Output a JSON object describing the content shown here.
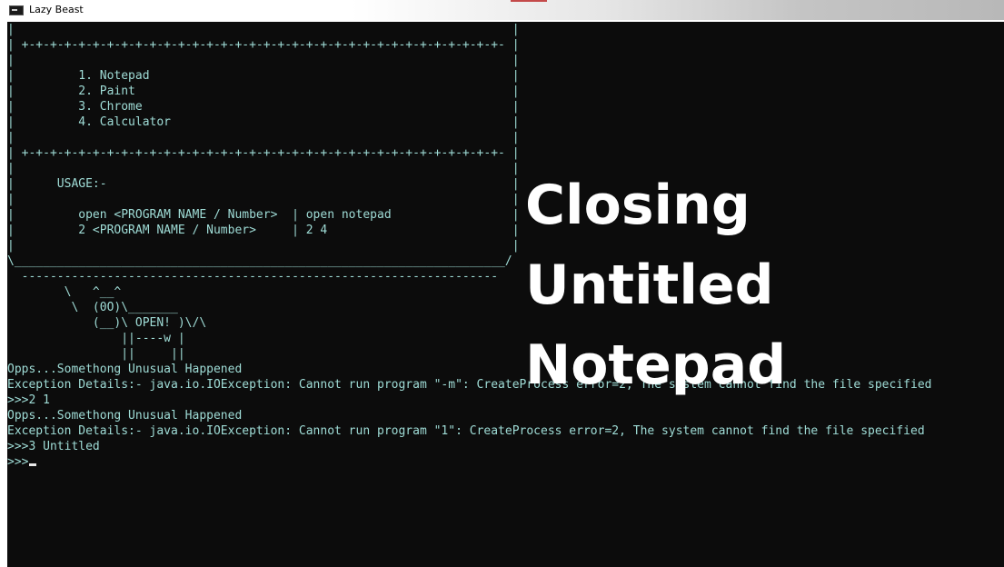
{
  "window": {
    "title": "Lazy Beast"
  },
  "console": {
    "lines": [
      "|                                                                      |",
      "| +-+-+-+-+-+-+-+-+-+-+-+-+-+-+-+-+-+-+-+-+-+-+-+-+-+-+-+-+-+-+-+-+-+- |",
      "|                                                                      |",
      "|         1. Notepad                                                   |",
      "|         2. Paint                                                     |",
      "|         3. Chrome                                                    |",
      "|         4. Calculator                                                |",
      "|                                                                      |",
      "| +-+-+-+-+-+-+-+-+-+-+-+-+-+-+-+-+-+-+-+-+-+-+-+-+-+-+-+-+-+-+-+-+-+- |",
      "|                                                                      |",
      "|      USAGE:-                                                         |",
      "|                                                                      |",
      "|         open <PROGRAM NAME / Number>  | open notepad                 |",
      "|         2 <PROGRAM NAME / Number>     | 2 4                          |",
      "|                                                                      |",
      "\\_____________________________________________________________________/",
      "  -------------------------------------------------------------------",
      "        \\   ^__^",
      "         \\  (0O)\\_______",
      "            (__)\\ OPEN! )\\/\\",
      "                ||----w |",
      "                ||     ||",
      "Opps...Somethong Unusual Happened",
      "Exception Details:- java.io.IOException: Cannot run program \"-m\": CreateProcess error=2, The system cannot find the file specified",
      ">>>2 1",
      "Opps...Somethong Unusual Happened",
      "Exception Details:- java.io.IOException: Cannot run program \"1\": CreateProcess error=2, The system cannot find the file specified",
      ">>>3 Untitled"
    ],
    "prompt": ">>>"
  },
  "overlay": {
    "line1": "Closing",
    "line2": "Untitled",
    "line3": "Notepad"
  },
  "colors": {
    "console_bg": "#0c0c0c",
    "console_text": "#9fdcd6",
    "overlay_text": "#ffffff"
  }
}
